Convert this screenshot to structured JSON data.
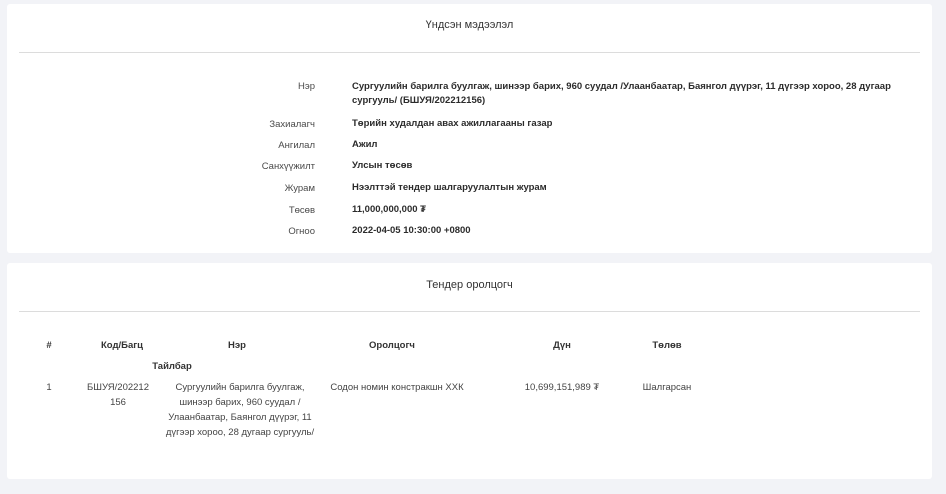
{
  "info": {
    "title": "Үндсэн мэдээлэл",
    "rows": [
      {
        "label": "Нэр",
        "value": "Сургуулийн барилга буулгаж, шинээр барих, 960 суудал /Улаанбаатар, Баянгол дүүрэг, 11 дүгээр хороо, 28 дугаар сургууль/ (БШУЯ/202212156)"
      },
      {
        "label": "Захиалагч",
        "value": "Төрийн худалдан авах ажиллагааны газар"
      },
      {
        "label": "Ангилал",
        "value": "Ажил"
      },
      {
        "label": "Санхүүжилт",
        "value": "Улсын төсөв"
      },
      {
        "label": "Журам",
        "value": "Нээлттэй тендер шалгаруулалтын журам"
      },
      {
        "label": "Төсөв",
        "value": "11,000,000,000 ₮"
      },
      {
        "label": "Огноо",
        "value": "2022-04-05 10:30:00 +0800"
      }
    ]
  },
  "bidders": {
    "title": "Тендер оролцогч",
    "headers": {
      "num": "#",
      "code": "Код/Багц",
      "name": "Нэр",
      "bidder": "Оролцогч",
      "amount": "Дүн",
      "status": "Төлөв",
      "description": "Тайлбар"
    },
    "rows": [
      {
        "num": "1",
        "code": "БШУЯ/202212156",
        "name": "Сургуулийн барилга буулгаж, шинээр барих, 960 суудал / Улаанбаатар, Баянгол дүүрэг, 11 дүгээр хороо, 28 дугаар сургууль/",
        "bidder": "Содон номин констракшн ХХК",
        "amount": "10,699,151,989 ₮",
        "status": "Шалгарсан"
      }
    ]
  }
}
